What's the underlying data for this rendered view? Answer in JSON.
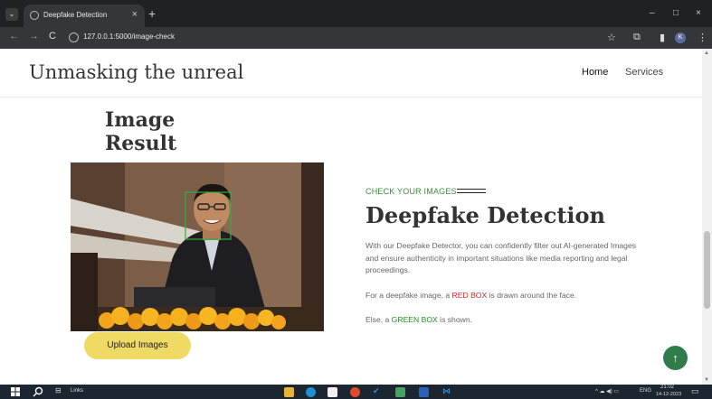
{
  "browser": {
    "tab_title": "Deepfake Detection",
    "tab_close": "×",
    "new_tab": "+",
    "url": "127.0.0.1:5000/image-check",
    "minimize": "–",
    "maximize": "□",
    "close": "×",
    "back": "←",
    "forward": "→",
    "reload": "C",
    "bookmark": "☆",
    "extensions": "⧉",
    "sidebar": "▮",
    "profile_initial": "K",
    "menu": "⋮",
    "tab_menu": "⌄"
  },
  "header": {
    "brand": "Unmasking the unreal",
    "nav": [
      "Home",
      "Services"
    ]
  },
  "result": {
    "title": "Image Result",
    "upload_button": "Upload Images"
  },
  "info": {
    "eyebrow": "CHECK YOUR IMAGES",
    "title": "Deepfake Detection",
    "description": "With our Deepfake Detector, you can confidently filter out AI-generated Images and ensure authenticity in important situations like media reporting and legal proceedings.",
    "fake_prefix": "For a deepfake image, a ",
    "fake_box": "RED BOX",
    "fake_suffix": " is drawn around the face.",
    "real_prefix": "Else, a ",
    "real_box": "GREEN BOX",
    "real_suffix": " is shown."
  },
  "scroll_top": "↑",
  "taskbar": {
    "links_label": "Links",
    "language": "ENG",
    "time": "21:02",
    "date": "14-12-2023"
  },
  "colors": {
    "accent_green": "#2f7d4a",
    "button_yellow": "#efda63",
    "red_box": "#d12828",
    "green_box": "#2a8a2a"
  }
}
